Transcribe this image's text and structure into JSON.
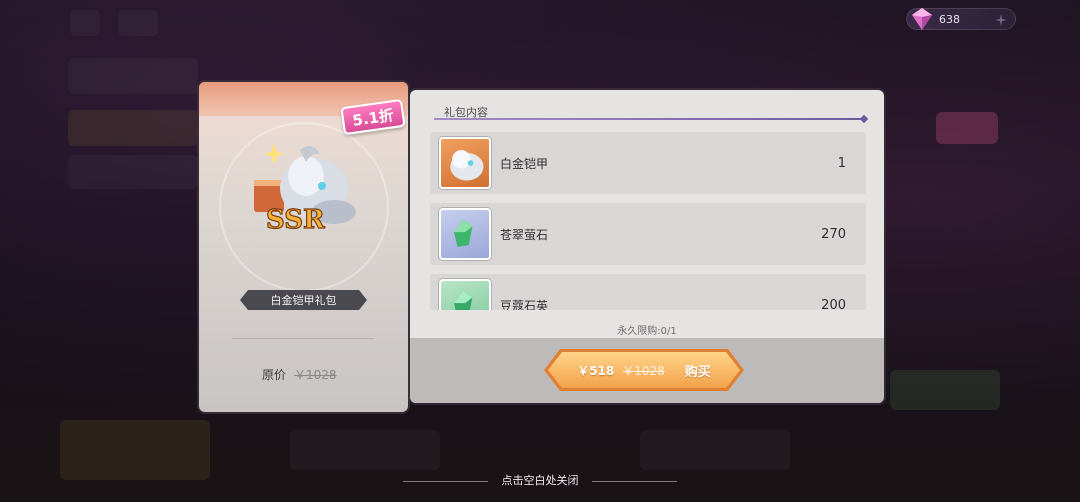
{
  "currency": {
    "amount": "638",
    "icon": "gem-icon"
  },
  "pack": {
    "discount_badge": "5.1折",
    "rarity": "SSR",
    "name": "白金铠甲礼包",
    "original_price_label": "原价",
    "original_price": "￥1028"
  },
  "contents": {
    "title": "礼包内容",
    "items": [
      {
        "name": "白金铠甲",
        "qty": "1",
        "icon": "armor-icon"
      },
      {
        "name": "苍翠萤石",
        "qty": "270",
        "icon": "crystal-icon"
      },
      {
        "name": "豆蔻石英",
        "qty": "200",
        "icon": "crystal-icon"
      }
    ],
    "limit_text": "永久限购:0/1"
  },
  "buy": {
    "price": "￥518",
    "old_price": "￥1028",
    "label": "购买"
  },
  "close_hint": "点击空白处关闭",
  "colors": {
    "buy_button": "#f2a24a",
    "discount_badge": "#d84d98",
    "title_line": "#6c5aa0"
  }
}
